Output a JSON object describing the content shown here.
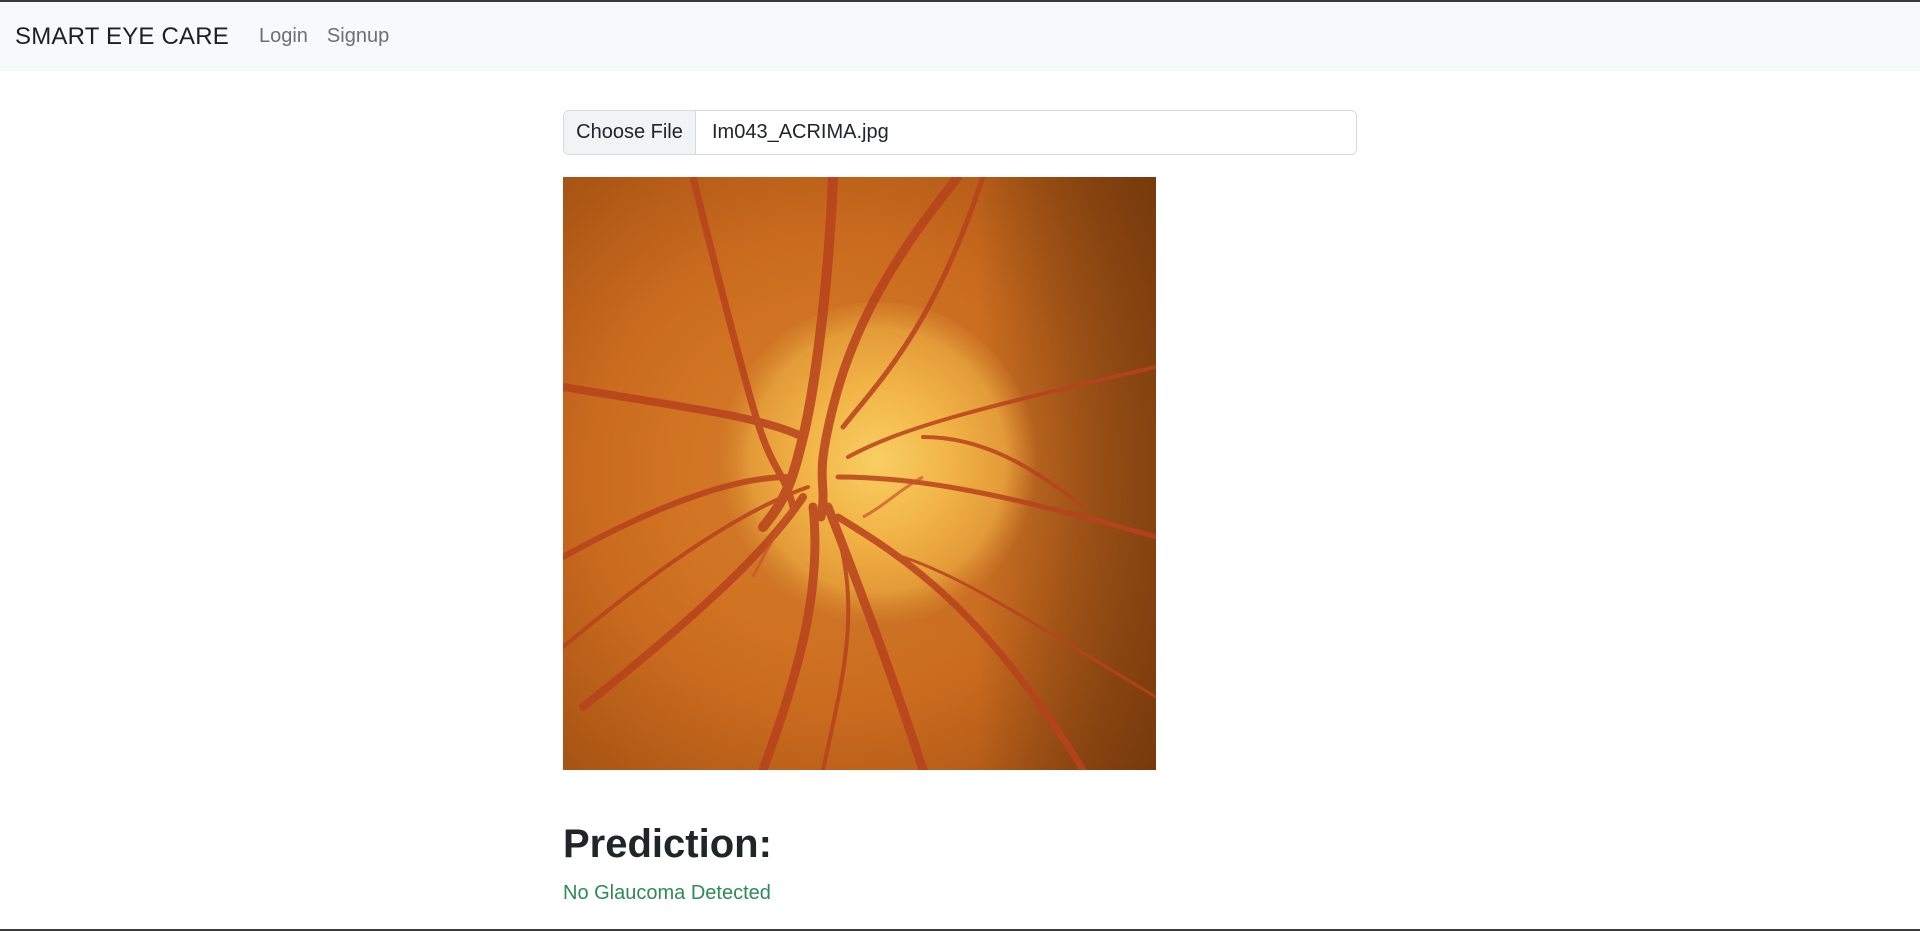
{
  "navbar": {
    "brand": "SMART EYE CARE",
    "links": [
      {
        "label": "Login"
      },
      {
        "label": "Signup"
      }
    ]
  },
  "upload": {
    "button_label": "Choose File",
    "file_name": "Im043_ACRIMA.jpg"
  },
  "prediction": {
    "title": "Prediction:",
    "result": "No Glaucoma Detected"
  },
  "colors": {
    "navbar_bg": "#f8f9fa",
    "result_text": "#2e8a57"
  }
}
